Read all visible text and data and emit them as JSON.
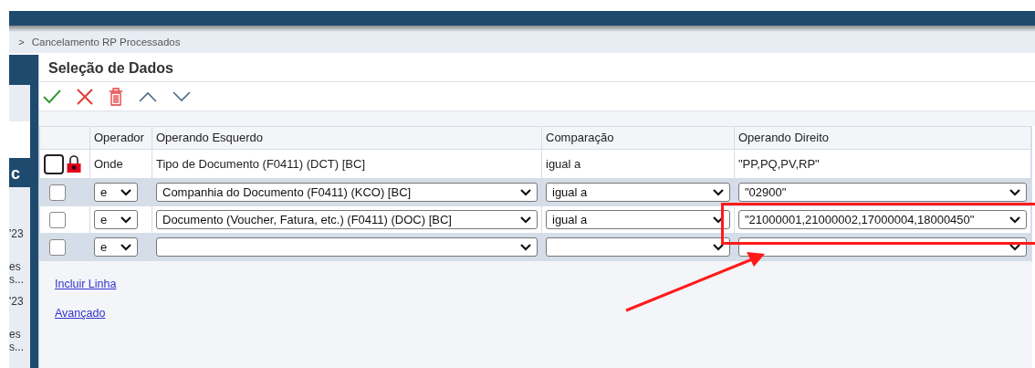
{
  "breadcrumb": {
    "separator": ">",
    "current": "Cancelamento RP Processados"
  },
  "sidebar_fragments": [
    {
      "text": "c",
      "kind": "icon-text"
    },
    {
      "text": "'23",
      "kind": "text"
    },
    {
      "text": "es",
      "kind": "text"
    },
    {
      "text": "s...",
      "kind": "text"
    },
    {
      "text": "'23",
      "kind": "text"
    },
    {
      "text": "es",
      "kind": "text"
    },
    {
      "text": "s...",
      "kind": "text"
    }
  ],
  "panel": {
    "title": "Seleção de Dados"
  },
  "table": {
    "columns": [
      "Operador",
      "Operando Esquerdo",
      "Comparação",
      "Operando Direito"
    ],
    "rows": [
      {
        "kind": "fixed",
        "checked": false,
        "locked": true,
        "operator": "Onde",
        "left": "Tipo de Documento (F0411) (DCT) [BC]",
        "comparison": "igual a",
        "right": "\"PP,PQ,PV,RP\""
      },
      {
        "kind": "editable",
        "checked": false,
        "locked": false,
        "operator": "e",
        "left": "Companhia do Documento (F0411) (KCO) [BC]",
        "comparison": "igual a",
        "right": "\"02900\""
      },
      {
        "kind": "editable",
        "checked": false,
        "locked": false,
        "operator": "e",
        "left": "Documento (Voucher, Fatura, etc.) (F0411) (DOC) [BC]",
        "comparison": "igual a",
        "right": "\"21000001,21000002,17000004,18000450\""
      },
      {
        "kind": "editable",
        "checked": false,
        "locked": false,
        "operator": "e"
      }
    ]
  },
  "links": [
    "Incluir Linha",
    "Avançado"
  ],
  "annotation": {
    "kind": "highlight-arrow"
  }
}
